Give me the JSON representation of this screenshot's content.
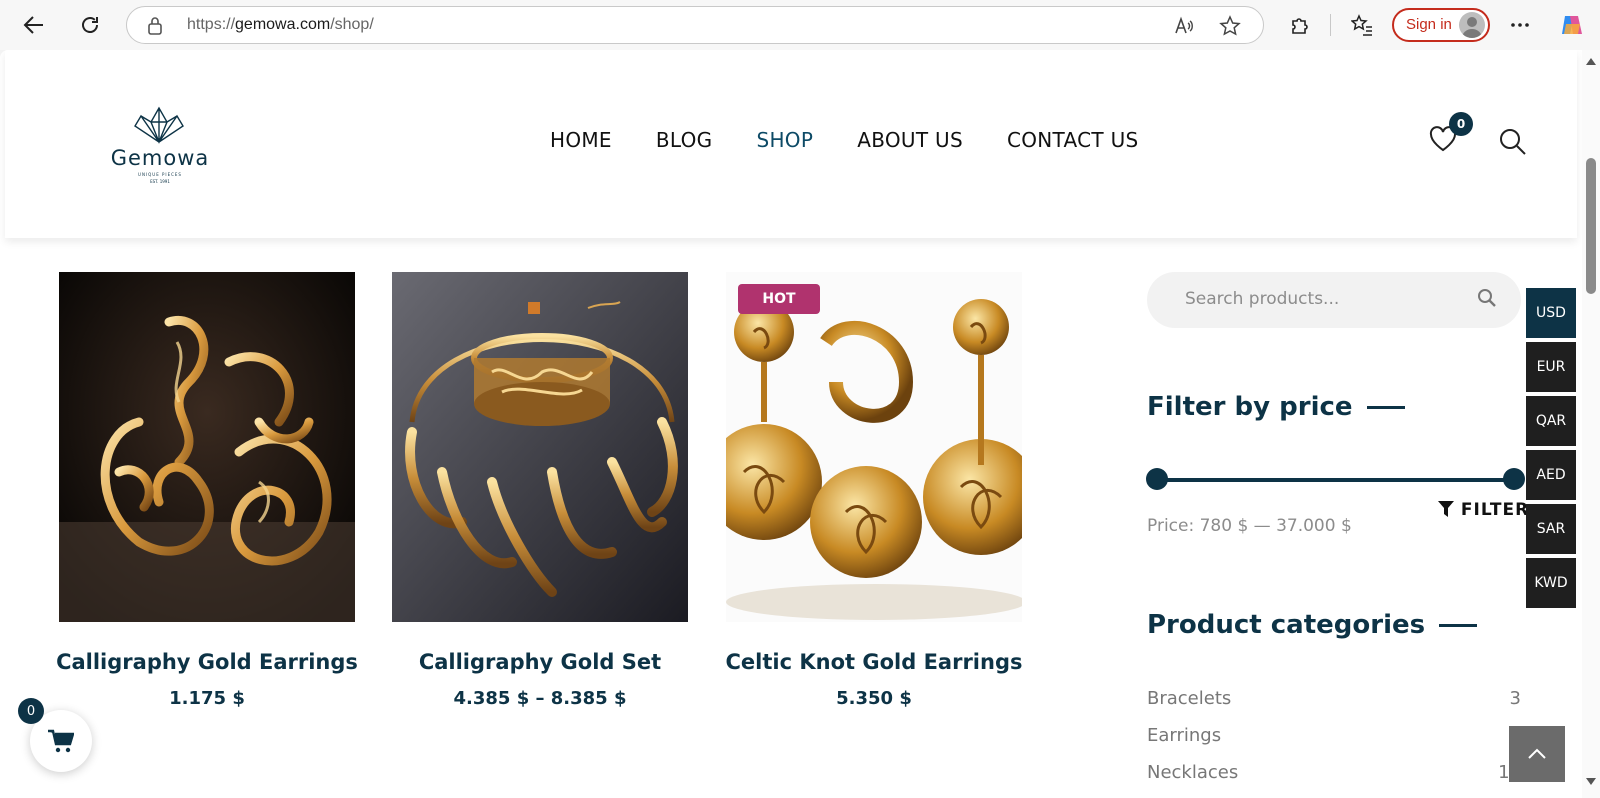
{
  "browser": {
    "url_prefix": "https://",
    "url_domain": "gemowa.com",
    "url_path": "/shop/",
    "signin_label": "Sign in"
  },
  "site": {
    "logo_text": "Gemowa",
    "logo_tagline": "UNIQUE PIECES",
    "logo_est": "EST. 1991",
    "nav": [
      "HOME",
      "BLOG",
      "SHOP",
      "ABOUT US",
      "CONTACT US"
    ],
    "active_nav": "SHOP",
    "wishlist_count": "0"
  },
  "products": [
    {
      "name": "Calligraphy Gold Earrings",
      "price": "1.175 $",
      "badge": ""
    },
    {
      "name": "Calligraphy Gold Set",
      "price": "4.385 $ – 8.385 $",
      "badge": ""
    },
    {
      "name": "Celtic Knot Gold Earrings",
      "price": "5.350 $",
      "badge": "HOT"
    }
  ],
  "sidebar": {
    "search_placeholder": "Search products...",
    "filter_title": "Filter by price",
    "price_label": "Price: 780 $ — 37.000 $",
    "filter_button": "FILTER",
    "categories_title": "Product categories",
    "categories": [
      {
        "name": "Bracelets",
        "count": "3"
      },
      {
        "name": "Earrings",
        "count": ""
      },
      {
        "name": "Necklaces",
        "count": "11"
      }
    ]
  },
  "currencies": [
    "USD",
    "EUR",
    "QAR",
    "AED",
    "SAR",
    "KWD"
  ],
  "active_currency": "USD",
  "cart_count": "0",
  "colors": {
    "brand": "#0d3346",
    "hot_badge": "#b0336e",
    "signin": "#c42b1c"
  }
}
